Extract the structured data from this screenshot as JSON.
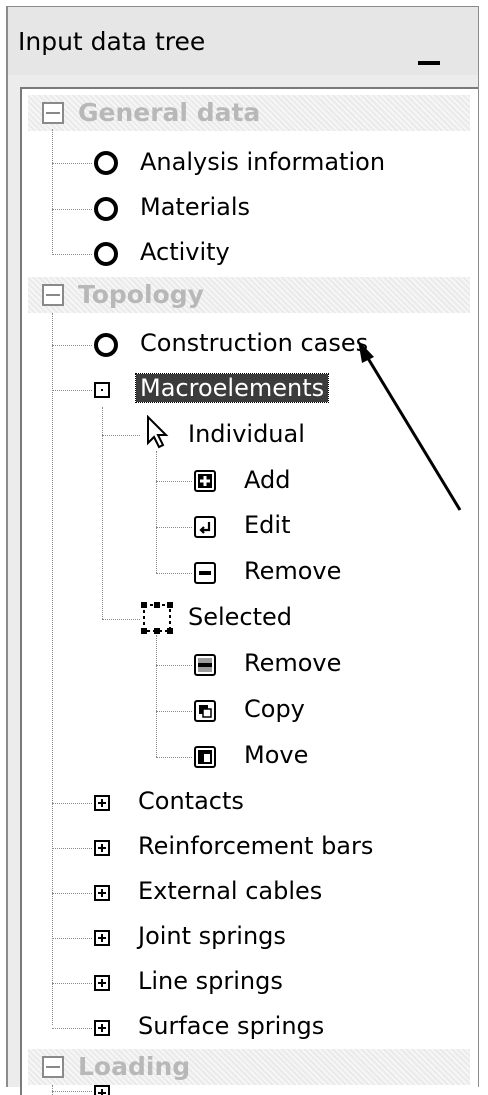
{
  "panel": {
    "title": "Input data tree"
  },
  "groups": [
    {
      "label": "General data"
    },
    {
      "label": "Topology"
    },
    {
      "label": "Loading"
    }
  ],
  "general_items": [
    "Analysis information",
    "Materials",
    "Activity"
  ],
  "topology": {
    "construction_cases": "Construction cases",
    "macroelements": "Macroelements",
    "individual": "Individual",
    "individual_children": [
      "Add",
      "Edit",
      "Remove"
    ],
    "selected": "Selected",
    "selected_children": [
      "Remove",
      "Copy",
      "Move"
    ],
    "collapsed": [
      "Contacts",
      "Reinforcement bars",
      "External cables",
      "Joint springs",
      "Line springs",
      "Surface springs"
    ]
  }
}
